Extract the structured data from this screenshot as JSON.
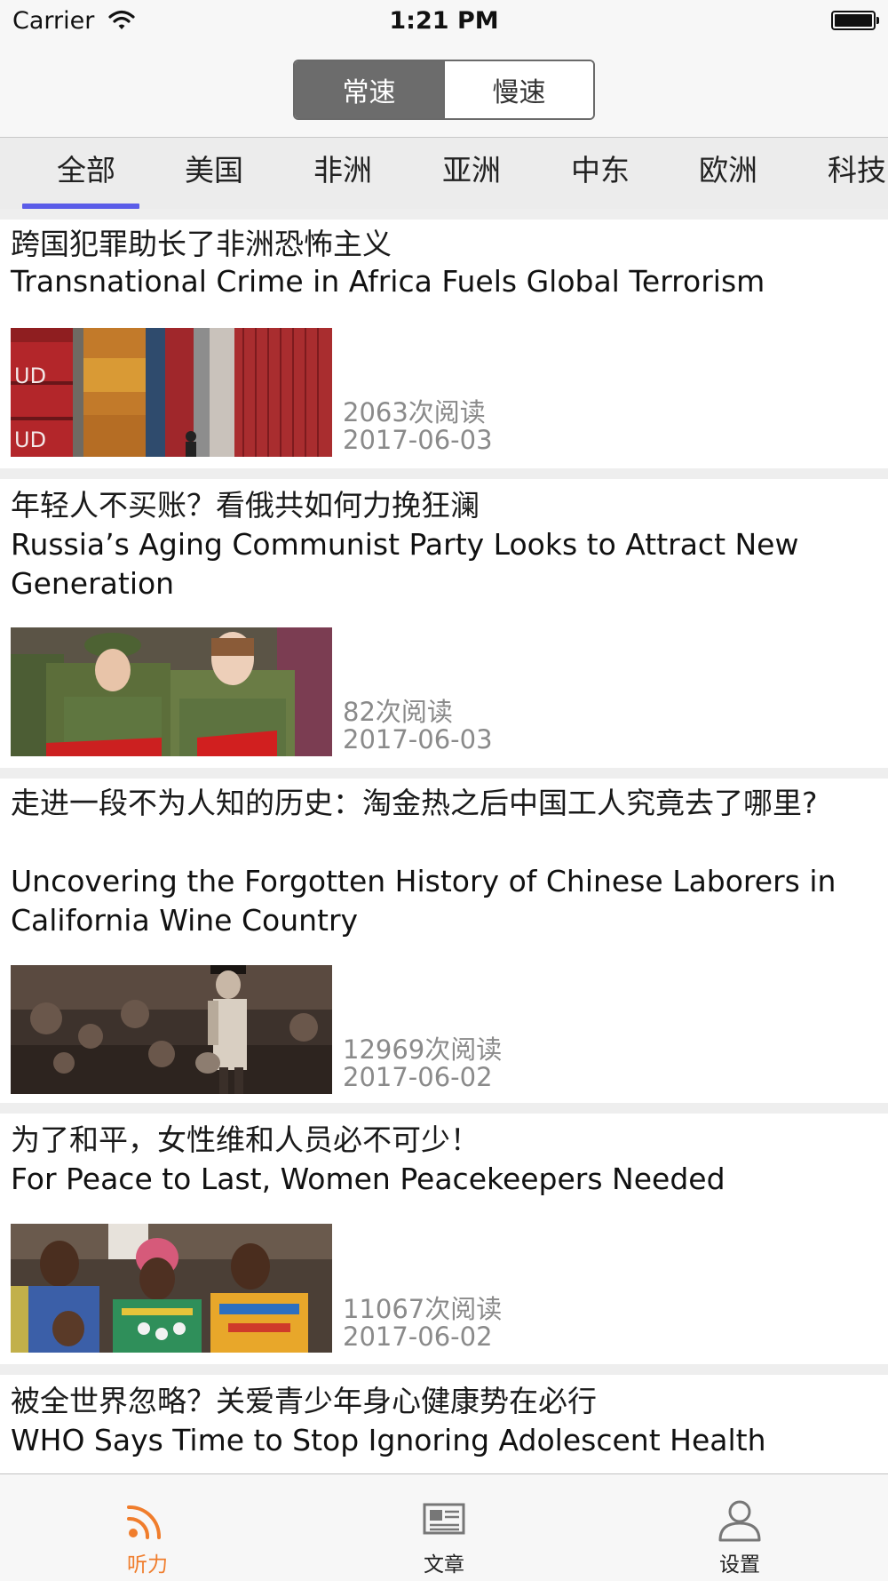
{
  "status_bar": {
    "carrier": "Carrier",
    "time": "1:21 PM"
  },
  "speed_segment": {
    "options": [
      "常速",
      "慢速"
    ],
    "selected": "常速"
  },
  "category_tabs": {
    "items": [
      "全部",
      "美国",
      "非洲",
      "亚洲",
      "中东",
      "欧洲",
      "科技"
    ],
    "selected": "全部"
  },
  "articles": [
    {
      "title_cn": "跨国犯罪助长了非洲恐怖主义",
      "title_en": "Transnational Crime in Africa Fuels Global Terrorism",
      "reads": "2063次阅读",
      "date": "2017-06-03",
      "image": "shipping-containers"
    },
    {
      "title_cn": "年轻人不买账？看俄共如何力挽狂澜",
      "title_en": "Russia’s Aging Communist Party Looks to Attract New Generation",
      "reads": "82次阅读",
      "date": "2017-06-03",
      "image": "youth-in-uniform"
    },
    {
      "title_cn": "走进一段不为人知的历史：淘金热之后中国工人究竟去了哪里?",
      "title_en": "Uncovering the Forgotten History of Chinese Laborers in California Wine Country",
      "reads": "12969次阅读",
      "date": "2017-06-02",
      "image": "historical-photo"
    },
    {
      "title_cn": "为了和平，女性维和人员必不可少！",
      "title_en": "For Peace to Last, Women Peacekeepers Needed",
      "reads": "11067次阅读",
      "date": "2017-06-02",
      "image": "women-group"
    },
    {
      "title_cn": "被全世界忽略？关爱青少年身心健康势在必行",
      "title_en": "WHO Says Time to Stop Ignoring Adolescent Health"
    }
  ],
  "tab_bar": {
    "items": [
      {
        "label": "听力",
        "icon": "rss-icon"
      },
      {
        "label": "文章",
        "icon": "newspaper-icon"
      },
      {
        "label": "设置",
        "icon": "person-icon"
      }
    ],
    "active": "听力",
    "active_color": "#f07d2c",
    "inactive_color": "#777777"
  },
  "colors": {
    "tab_underline": "#5a5ce8",
    "segment_active": "#6c6c6c"
  }
}
